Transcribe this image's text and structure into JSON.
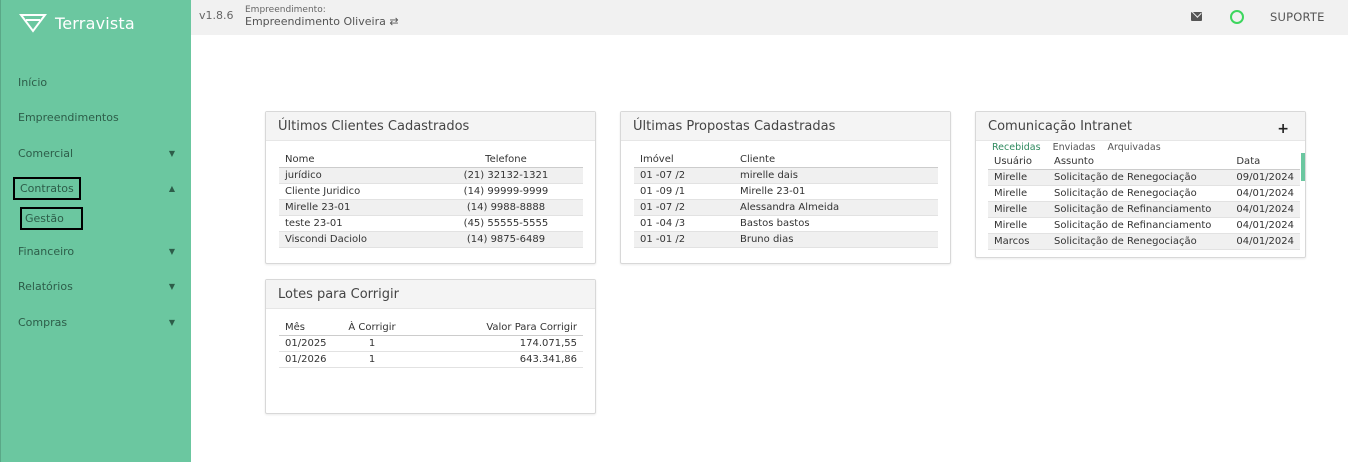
{
  "brand": {
    "name": "Terravista",
    "logo_icon": "terravista-logo-icon"
  },
  "topbar": {
    "version": "v1.8.6",
    "empreendimento_label": "Empreendimento:",
    "empreendimento_name": "Empreendimento Oliveira ⇄",
    "support_label": "SUPORTE"
  },
  "sidebar": {
    "items": [
      {
        "label": "Início"
      },
      {
        "label": "Empreendimentos"
      },
      {
        "label": "Comercial",
        "caret": "▼"
      },
      {
        "label": "Contratos",
        "caret": "▲"
      },
      {
        "label": "Gestão"
      },
      {
        "label": "Financeiro",
        "caret": "▼"
      },
      {
        "label": "Relatórios",
        "caret": "▼"
      },
      {
        "label": "Compras",
        "caret": "▼"
      }
    ]
  },
  "clientes": {
    "title": "Últimos Clientes Cadastrados",
    "headers": [
      "Nome",
      "Telefone"
    ],
    "rows": [
      [
        "jurídico",
        "(21) 32132-1321"
      ],
      [
        "Cliente Juridico",
        "(14) 99999-9999"
      ],
      [
        "Mirelle 23-01",
        "(14) 9988-8888"
      ],
      [
        "teste 23-01",
        "(45) 55555-5555"
      ],
      [
        "Viscondi Daciolo",
        "(14) 9875-6489"
      ]
    ]
  },
  "propostas": {
    "title": "Últimas Propostas Cadastradas",
    "headers": [
      "Imóvel",
      "Cliente"
    ],
    "rows": [
      [
        "01 -07 /2",
        "mirelle dais"
      ],
      [
        "01 -09 /1",
        "Mirelle 23-01"
      ],
      [
        "01 -07 /2",
        "Alessandra Almeida"
      ],
      [
        "01 -04 /3",
        "Bastos bastos"
      ],
      [
        "01 -01 /2",
        "Bruno dias"
      ]
    ]
  },
  "intranet": {
    "title": "Comunicação Intranet",
    "tabs": [
      "Recebidas",
      "Enviadas",
      "Arquivadas"
    ],
    "headers": [
      "Usuário",
      "Assunto",
      "Data"
    ],
    "rows": [
      [
        "Mirelle",
        "Solicitação de Renegociação",
        "09/01/2024"
      ],
      [
        "Mirelle",
        "Solicitação de Renegociação",
        "04/01/2024"
      ],
      [
        "Mirelle",
        "Solicitação de Refinanciamento",
        "04/01/2024"
      ],
      [
        "Mirelle",
        "Solicitação de Refinanciamento",
        "04/01/2024"
      ],
      [
        "Marcos",
        "Solicitação de Renegociação",
        "04/01/2024"
      ]
    ]
  },
  "lotes": {
    "title": "Lotes para Corrigir",
    "headers": [
      "Mês",
      "À Corrigir",
      "Valor Para Corrigir"
    ],
    "rows": [
      [
        "01/2025",
        "1",
        "174.071,55"
      ],
      [
        "01/2026",
        "1",
        "643.341,86"
      ]
    ]
  },
  "colors": {
    "sidebar": "#6bc7a0",
    "accent": "#2f8a5f",
    "status": "#3dd65e"
  }
}
